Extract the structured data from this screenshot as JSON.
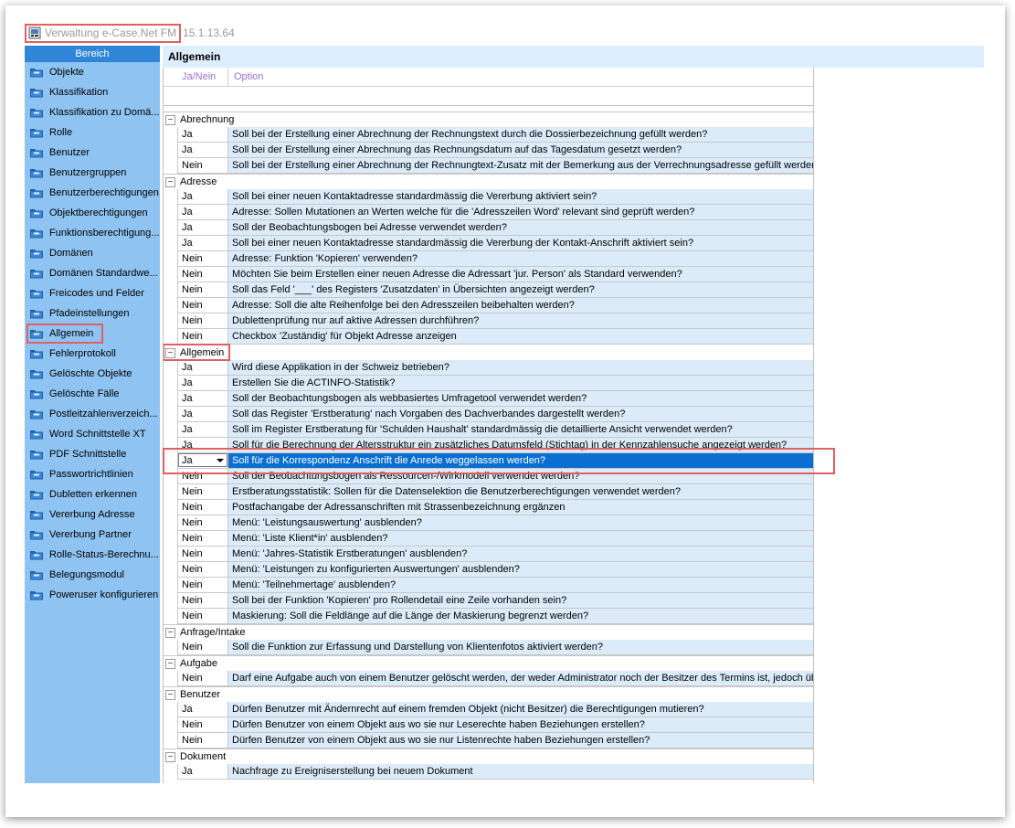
{
  "window": {
    "title": "Verwaltung e-Case.Net FM",
    "version": "15.1.13.64"
  },
  "sidebar": {
    "header": "Bereich",
    "items": [
      {
        "label": "Objekte"
      },
      {
        "label": "Klassifikation"
      },
      {
        "label": "Klassifikation zu Domä..."
      },
      {
        "label": "Rolle"
      },
      {
        "label": "Benutzer"
      },
      {
        "label": "Benutzergruppen"
      },
      {
        "label": "Benutzerberechtigungen"
      },
      {
        "label": "Objektberechtigungen"
      },
      {
        "label": "Funktionsberechtigung..."
      },
      {
        "label": "Domänen"
      },
      {
        "label": "Domänen Standardwe..."
      },
      {
        "label": "Freicodes und Felder"
      },
      {
        "label": "Pfadeinstellungen"
      },
      {
        "label": "Allgemein",
        "selected": true
      },
      {
        "label": "Fehlerprotokoll"
      },
      {
        "label": "Gelöschte Objekte"
      },
      {
        "label": "Gelöschte Fälle"
      },
      {
        "label": "Postleitzahlenverzeich..."
      },
      {
        "label": "Word Schnittstelle XT"
      },
      {
        "label": "PDF Schnittstelle"
      },
      {
        "label": "Passwortrichtlinien"
      },
      {
        "label": "Dubletten erkennen"
      },
      {
        "label": "Vererbung Adresse"
      },
      {
        "label": "Vererbung Partner"
      },
      {
        "label": "Rolle-Status-Berechnu..."
      },
      {
        "label": "Belegungsmodul"
      },
      {
        "label": "Poweruser konfigurieren"
      }
    ]
  },
  "main": {
    "title": "Allgemein",
    "columns": {
      "jn": "Ja/Nein",
      "option": "Option"
    },
    "groups": [
      {
        "name": "Abrechnung",
        "toggle": "−",
        "rows": [
          {
            "jn": "Ja",
            "text": "Soll bei der Erstellung einer Abrechnung der Rechnungstext durch die Dossierbezeichnung gefüllt werden?"
          },
          {
            "jn": "Ja",
            "text": "Soll bei der Erstellung einer Abrechnung das Rechnungsdatum auf das Tagesdatum gesetzt werden?"
          },
          {
            "jn": "Nein",
            "text": "Soll bei der Erstellung einer Abrechnung der Rechnungtext-Zusatz mit der Bemerkung aus der Verrechnungsadresse gefüllt werden?"
          }
        ]
      },
      {
        "name": "Adresse",
        "toggle": "−",
        "rows": [
          {
            "jn": "Ja",
            "text": "Soll bei einer neuen Kontaktadresse standardmässig die Vererbung aktiviert sein?"
          },
          {
            "jn": "Ja",
            "text": "Adresse: Sollen Mutationen an Werten welche für die 'Adresszeilen Word' relevant sind geprüft werden?"
          },
          {
            "jn": "Ja",
            "text": "Soll der Beobachtungsbogen bei Adresse verwendet werden?"
          },
          {
            "jn": "Ja",
            "text": "Soll bei einer neuen Kontaktadresse standardmässig die Vererbung der Kontakt-Anschrift aktiviert sein?"
          },
          {
            "jn": "Nein",
            "text": "Adresse: Funktion 'Kopieren' verwenden?"
          },
          {
            "jn": "Nein",
            "text": "Möchten Sie beim Erstellen einer neuen Adresse die Adressart 'jur. Person' als Standard verwenden?"
          },
          {
            "jn": "Nein",
            "text": "Soll das Feld '___' des Registers 'Zusatzdaten' in Übersichten angezeigt werden?"
          },
          {
            "jn": "Nein",
            "text": "Adresse: Soll die alte Reihenfolge bei den Adresszeilen beibehalten werden?"
          },
          {
            "jn": "Nein",
            "text": "Dublettenprüfung nur auf aktive Adressen durchführen?"
          },
          {
            "jn": "Nein",
            "text": "Checkbox 'Zuständig' für Objekt Adresse anzeigen"
          }
        ]
      },
      {
        "name": "Allgemein",
        "toggle": "−",
        "highlight": true,
        "rows": [
          {
            "jn": "Ja",
            "text": "Wird diese Applikation in der Schweiz betrieben?"
          },
          {
            "jn": "Ja",
            "text": "Erstellen Sie die ACTINFO-Statistik?"
          },
          {
            "jn": "Ja",
            "text": "Soll der Beobachtungsbogen als webbasiertes Umfragetool verwendet werden?"
          },
          {
            "jn": "Ja",
            "text": "Soll das Register 'Erstberatung' nach Vorgaben des Dachverbandes dargestellt werden?"
          },
          {
            "jn": "Ja",
            "text": "Soll im Register Erstberatung für 'Schulden Haushalt' standardmässig die detaillierte Ansicht verwendet werden?"
          },
          {
            "jn": "Ja",
            "text": "Soll für die Berechnung der Altersstruktur ein zusätzliches Datumsfeld (Stichtag) in der Kennzahlensuche angezeigt werden?"
          },
          {
            "jn": "Ja",
            "text": "Soll für die Korrespondenz Anschrift die Anrede weggelassen werden?",
            "active": true
          },
          {
            "jn": "Nein",
            "text": "Soll der Beobachtungsbogen als Ressourcen-/Wirkmodell verwendet werden?"
          },
          {
            "jn": "Nein",
            "text": "Erstberatungsstatistik: Sollen für die Datenselektion die Benutzerberechtigungen verwendet werden?"
          },
          {
            "jn": "Nein",
            "text": "Postfachangabe der Adressanschriften mit Strassenbezeichnung ergänzen"
          },
          {
            "jn": "Nein",
            "text": "Menü: 'Leistungsauswertung' ausblenden?"
          },
          {
            "jn": "Nein",
            "text": "Menü: 'Liste Klient*in' ausblenden?"
          },
          {
            "jn": "Nein",
            "text": "Menü: 'Jahres-Statistik Erstberatungen' ausblenden?"
          },
          {
            "jn": "Nein",
            "text": "Menü: 'Leistungen zu konfigurierten Auswertungen' ausblenden?"
          },
          {
            "jn": "Nein",
            "text": "Menü: 'Teilnehmertage' ausblenden?"
          },
          {
            "jn": "Nein",
            "text": "Soll bei der Funktion 'Kopieren' pro Rollendetail eine Zeile vorhanden sein?"
          },
          {
            "jn": "Nein",
            "text": "Maskierung: Soll die Feldlänge auf die Länge der Maskierung begrenzt werden?"
          }
        ]
      },
      {
        "name": "Anfrage/Intake",
        "toggle": "−",
        "rows": [
          {
            "jn": "Nein",
            "text": "Soll die Funktion zur Erfassung und Darstellung von Klientenfotos aktiviert werden?"
          }
        ]
      },
      {
        "name": "Aufgabe",
        "toggle": "−",
        "rows": [
          {
            "jn": "Nein",
            "text": "Darf eine Aufgabe auch von einem Benutzer gelöscht werden, der weder Administrator noch der Besitzer des Termins ist, jedoch üb..."
          }
        ]
      },
      {
        "name": "Benutzer",
        "toggle": "−",
        "rows": [
          {
            "jn": "Ja",
            "text": "Dürfen Benutzer mit Ändernrecht auf einem fremden Objekt (nicht Besitzer) die Berechtigungen mutieren?"
          },
          {
            "jn": "Nein",
            "text": "Dürfen Benutzer von einem Objekt aus wo sie nur Leserechte haben Beziehungen erstellen?"
          },
          {
            "jn": "Nein",
            "text": "Dürfen Benutzer von einem Objekt aus wo sie nur Listenrechte haben Beziehungen erstellen?"
          }
        ]
      },
      {
        "name": "Dokument",
        "toggle": "−",
        "rows": [
          {
            "jn": "Ja",
            "text": "Nachfrage zu Ereigniserstellung bei neuem Dokument"
          }
        ]
      }
    ]
  }
}
